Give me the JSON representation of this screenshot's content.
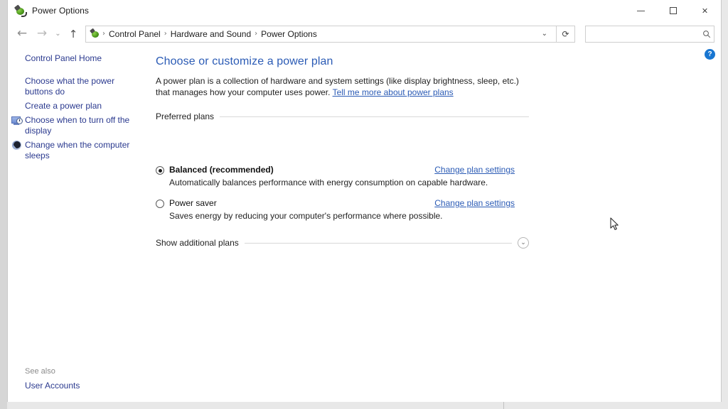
{
  "window": {
    "title": "Power Options",
    "app_icon": "power-plug-icon",
    "controls": {
      "minimize": "Minimize",
      "maximize": "Maximize",
      "close": "Close"
    }
  },
  "navbar": {
    "back": "←",
    "forward": "→",
    "recent": "⌄",
    "up": "↑",
    "breadcrumbs": [
      "Control Panel",
      "Hardware and Sound",
      "Power Options"
    ],
    "separator": "›",
    "dropdown": "⌄",
    "refresh": "⟳",
    "search": {
      "value": "",
      "placeholder": "",
      "icon": "search-icon"
    }
  },
  "help": {
    "label": "?"
  },
  "sidebar": {
    "home": "Control Panel Home",
    "items": [
      {
        "label": "Choose what the power buttons do",
        "icon": null
      },
      {
        "label": "Create a power plan",
        "icon": null
      },
      {
        "label": "Choose when to turn off the display",
        "icon": "display-clock-icon"
      },
      {
        "label": "Change when the computer sleeps",
        "icon": "sleep-moon-icon"
      }
    ],
    "see_also_label": "See also",
    "see_also_link": "User Accounts"
  },
  "main": {
    "heading": "Choose or customize a power plan",
    "description_part1": "A power plan is a collection of hardware and system settings (like display brightness, sleep, etc.) that manages how your computer uses power. ",
    "description_link": "Tell me more about power plans",
    "preferred_plans_label": "Preferred plans",
    "plans": [
      {
        "name": "Balanced (recommended)",
        "description": "Automatically balances performance with energy consumption on capable hardware.",
        "selected": true,
        "link": "Change plan settings"
      },
      {
        "name": "Power saver",
        "description": "Saves energy by reducing your computer's performance where possible.",
        "selected": false,
        "link": "Change plan settings"
      }
    ],
    "show_additional_label": "Show additional plans",
    "show_additional_chevron": "⌄"
  },
  "colors": {
    "link": "#2b5bb5",
    "sidebar_link": "#2b3a8f",
    "heading": "#2b5bb5",
    "help_badge": "#1876d1"
  }
}
